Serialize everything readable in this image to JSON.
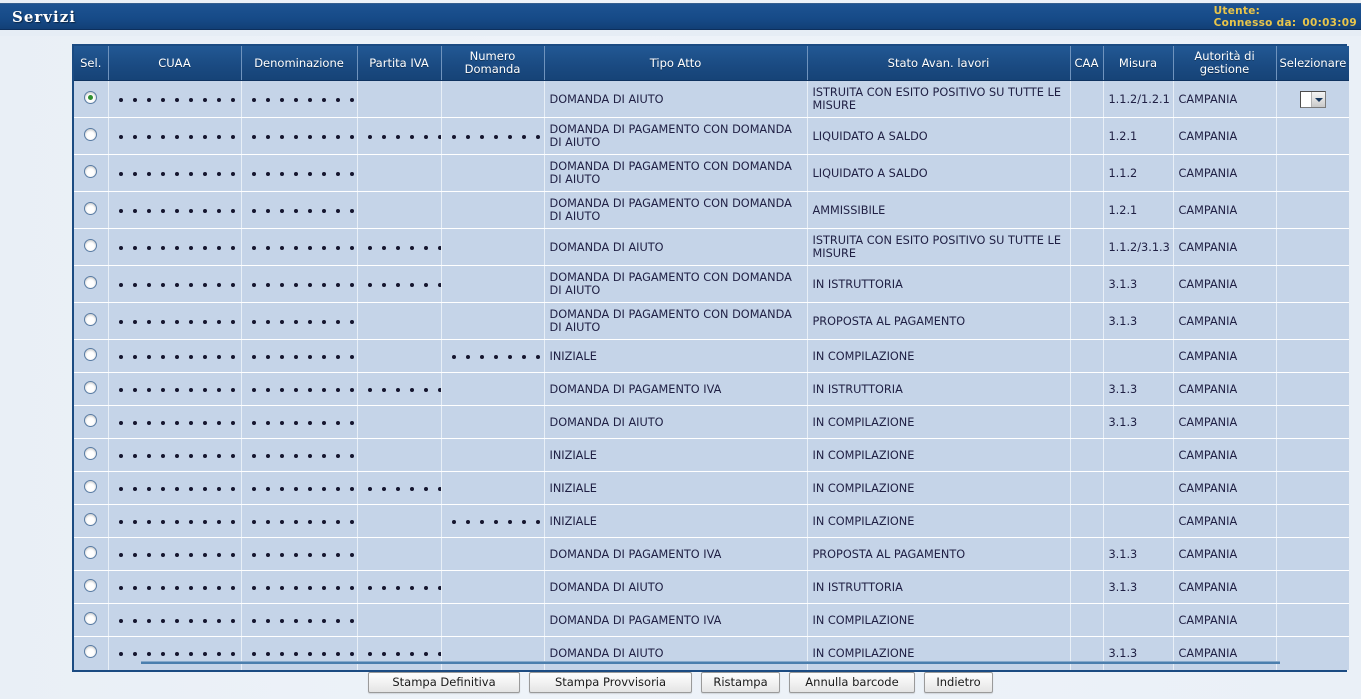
{
  "topbar": {
    "title": "Servizi",
    "user_label": "Utente:",
    "connected_label": "Connesso da:",
    "connected_time": "00:03:09",
    "bar_color": "#1a4f8f",
    "text_color": "#e9c54a"
  },
  "table": {
    "headers": {
      "sel": "Sel.",
      "cuaa": "CUAA",
      "denominazione": "Denominazione",
      "partita_iva": "Partita IVA",
      "numero_domanda": "Numero Domanda",
      "tipo_atto": "Tipo Atto",
      "stato": "Stato Avan. lavori",
      "caa": "CAA",
      "misura": "Misura",
      "autorita": "Autorità di gestione",
      "selezionare": "Selezionare"
    },
    "masked_glyph": "•",
    "rows": [
      {
        "selected": true,
        "cuaa_dots": 11,
        "den_dots": 9,
        "piva_dots": 0,
        "nd_dots": 0,
        "tipo": "DOMANDA DI AIUTO",
        "stato": "ISTRUITA CON ESITO POSITIVO SU TUTTE LE MISURE",
        "caa": "",
        "misura": "1.1.2/1.2.1",
        "autorita": "CAMPANIA",
        "has_select": true
      },
      {
        "selected": false,
        "cuaa_dots": 11,
        "den_dots": 9,
        "piva_dots": 7,
        "nd_dots": 7,
        "tipo": "DOMANDA DI PAGAMENTO CON DOMANDA DI AIUTO",
        "stato": "LIQUIDATO A SALDO",
        "caa": "",
        "misura": "1.2.1",
        "autorita": "CAMPANIA",
        "has_select": false
      },
      {
        "selected": false,
        "cuaa_dots": 11,
        "den_dots": 9,
        "piva_dots": 0,
        "nd_dots": 0,
        "tipo": "DOMANDA DI PAGAMENTO CON DOMANDA DI AIUTO",
        "stato": "LIQUIDATO A SALDO",
        "caa": "",
        "misura": "1.1.2",
        "autorita": "CAMPANIA",
        "has_select": false
      },
      {
        "selected": false,
        "cuaa_dots": 11,
        "den_dots": 9,
        "piva_dots": 0,
        "nd_dots": 0,
        "tipo": "DOMANDA DI PAGAMENTO CON DOMANDA DI AIUTO",
        "stato": "AMMISSIBILE",
        "caa": "",
        "misura": "1.2.1",
        "autorita": "CAMPANIA",
        "has_select": false
      },
      {
        "selected": false,
        "cuaa_dots": 11,
        "den_dots": 9,
        "piva_dots": 6,
        "nd_dots": 0,
        "tipo": "DOMANDA DI AIUTO",
        "stato": "ISTRUITA CON ESITO POSITIVO SU TUTTE LE MISURE",
        "caa": "",
        "misura": "1.1.2/3.1.3",
        "autorita": "CAMPANIA",
        "has_select": false
      },
      {
        "selected": false,
        "cuaa_dots": 11,
        "den_dots": 9,
        "piva_dots": 6,
        "nd_dots": 0,
        "tipo": "DOMANDA DI PAGAMENTO CON DOMANDA DI AIUTO",
        "stato": "IN ISTRUTTORIA",
        "caa": "",
        "misura": "3.1.3",
        "autorita": "CAMPANIA",
        "has_select": false
      },
      {
        "selected": false,
        "cuaa_dots": 11,
        "den_dots": 9,
        "piva_dots": 0,
        "nd_dots": 0,
        "tipo": "DOMANDA DI PAGAMENTO CON DOMANDA DI AIUTO",
        "stato": "PROPOSTA AL PAGAMENTO",
        "caa": "",
        "misura": "3.1.3",
        "autorita": "CAMPANIA",
        "has_select": false
      },
      {
        "selected": false,
        "cuaa_dots": 11,
        "den_dots": 9,
        "piva_dots": 0,
        "nd_dots": 7,
        "tipo": "INIZIALE",
        "stato": "IN COMPILAZIONE",
        "caa": "",
        "misura": "",
        "autorita": "CAMPANIA",
        "has_select": false
      },
      {
        "selected": false,
        "cuaa_dots": 11,
        "den_dots": 9,
        "piva_dots": 6,
        "nd_dots": 0,
        "tipo": "DOMANDA DI PAGAMENTO IVA",
        "stato": "IN ISTRUTTORIA",
        "caa": "",
        "misura": "3.1.3",
        "autorita": "CAMPANIA",
        "has_select": false
      },
      {
        "selected": false,
        "cuaa_dots": 11,
        "den_dots": 9,
        "piva_dots": 0,
        "nd_dots": 0,
        "tipo": "DOMANDA DI AIUTO",
        "stato": "IN COMPILAZIONE",
        "caa": "",
        "misura": "3.1.3",
        "autorita": "CAMPANIA",
        "has_select": false
      },
      {
        "selected": false,
        "cuaa_dots": 11,
        "den_dots": 9,
        "piva_dots": 0,
        "nd_dots": 0,
        "tipo": "INIZIALE",
        "stato": "IN COMPILAZIONE",
        "caa": "",
        "misura": "",
        "autorita": "CAMPANIA",
        "has_select": false
      },
      {
        "selected": false,
        "cuaa_dots": 11,
        "den_dots": 9,
        "piva_dots": 6,
        "nd_dots": 0,
        "tipo": "INIZIALE",
        "stato": "IN COMPILAZIONE",
        "caa": "",
        "misura": "",
        "autorita": "CAMPANIA",
        "has_select": false
      },
      {
        "selected": false,
        "cuaa_dots": 11,
        "den_dots": 9,
        "piva_dots": 0,
        "nd_dots": 8,
        "tipo": "INIZIALE",
        "stato": "IN COMPILAZIONE",
        "caa": "",
        "misura": "",
        "autorita": "CAMPANIA",
        "has_select": false
      },
      {
        "selected": false,
        "cuaa_dots": 11,
        "den_dots": 9,
        "piva_dots": 0,
        "nd_dots": 0,
        "tipo": "DOMANDA DI PAGAMENTO IVA",
        "stato": "PROPOSTA AL PAGAMENTO",
        "caa": "",
        "misura": "3.1.3",
        "autorita": "CAMPANIA",
        "has_select": false
      },
      {
        "selected": false,
        "cuaa_dots": 11,
        "den_dots": 9,
        "piva_dots": 6,
        "nd_dots": 0,
        "tipo": "DOMANDA DI AIUTO",
        "stato": "IN ISTRUTTORIA",
        "caa": "",
        "misura": "3.1.3",
        "autorita": "CAMPANIA",
        "has_select": false
      },
      {
        "selected": false,
        "cuaa_dots": 11,
        "den_dots": 9,
        "piva_dots": 0,
        "nd_dots": 0,
        "tipo": "DOMANDA DI PAGAMENTO IVA",
        "stato": "IN COMPILAZIONE",
        "caa": "",
        "misura": "",
        "autorita": "CAMPANIA",
        "has_select": false
      },
      {
        "selected": false,
        "cuaa_dots": 11,
        "den_dots": 9,
        "piva_dots": 6,
        "nd_dots": 0,
        "tipo": "DOMANDA DI AIUTO",
        "stato": "IN COMPILAZIONE",
        "caa": "",
        "misura": "3.1.3",
        "autorita": "CAMPANIA",
        "has_select": false
      }
    ]
  },
  "footer": {
    "buttons": [
      {
        "label": "Stampa Definitiva",
        "key": "stampa-definitiva",
        "cls": "w-def"
      },
      {
        "label": "Stampa Provvisoria",
        "key": "stampa-provvisoria",
        "cls": "w-prov"
      },
      {
        "label": "Ristampa",
        "key": "ristampa",
        "cls": "w-ris"
      },
      {
        "label": "Annulla barcode",
        "key": "annulla-barcode",
        "cls": "w-ann"
      },
      {
        "label": "Indietro",
        "key": "indietro",
        "cls": "w-ind"
      }
    ]
  }
}
